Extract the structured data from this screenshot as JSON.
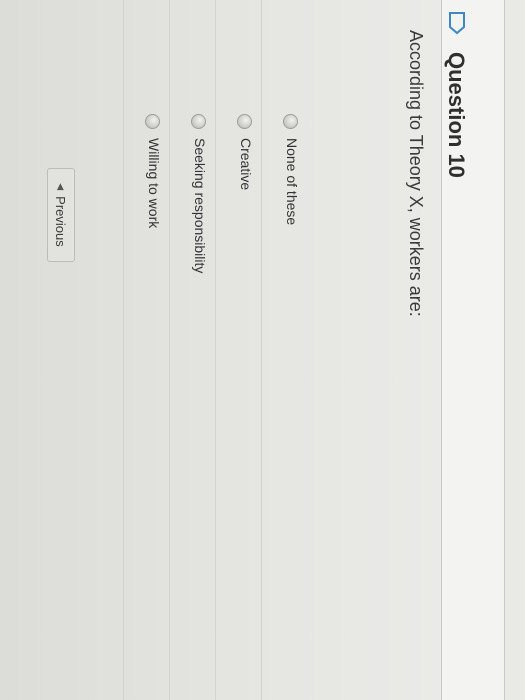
{
  "question": {
    "title": "Question 10",
    "prompt": "According to Theory X, workers are:",
    "bookmark_icon": "bookmark-flag-icon"
  },
  "answers": [
    {
      "label": "None of these"
    },
    {
      "label": "Creative"
    },
    {
      "label": "Seeking responsibility"
    },
    {
      "label": "Willing to work"
    }
  ],
  "nav": {
    "previous_label": "Previous",
    "previous_icon": "triangle-left-icon"
  },
  "colors": {
    "accent_icon": "#3f88c5",
    "page_background": "#e6e6e3"
  }
}
